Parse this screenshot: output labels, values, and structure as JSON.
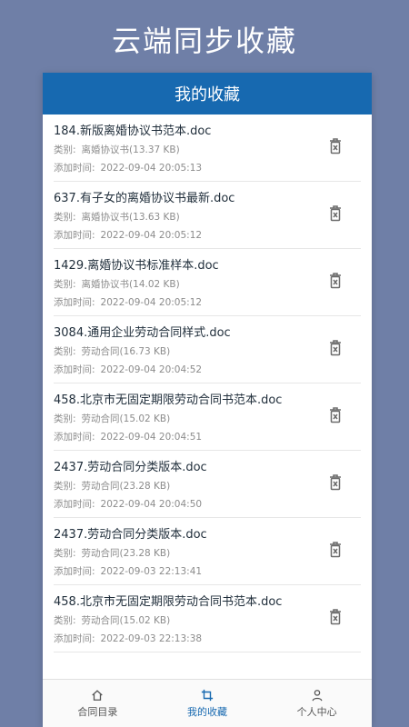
{
  "header": {
    "title": "云端同步收藏"
  },
  "card": {
    "title": "我的收藏"
  },
  "labels": {
    "category": "类别:",
    "added": "添加时间:"
  },
  "items": [
    {
      "name": "184.新版离婚协议书范本.doc",
      "category": "离婚协议书",
      "size": "(13.37 KB)",
      "time": "2022-09-04 20:05:13"
    },
    {
      "name": "637.有子女的离婚协议书最新.doc",
      "category": "离婚协议书",
      "size": "(13.63 KB)",
      "time": "2022-09-04 20:05:12"
    },
    {
      "name": "1429.离婚协议书标准样本.doc",
      "category": "离婚协议书",
      "size": "(14.02 KB)",
      "time": "2022-09-04 20:05:12"
    },
    {
      "name": "3084.通用企业劳动合同样式.doc",
      "category": "劳动合同",
      "size": "(16.73 KB)",
      "time": "2022-09-04 20:04:52"
    },
    {
      "name": "458.北京市无固定期限劳动合同书范本.doc",
      "category": "劳动合同",
      "size": "(15.02 KB)",
      "time": "2022-09-04 20:04:51"
    },
    {
      "name": "2437.劳动合同分类版本.doc",
      "category": "劳动合同",
      "size": "(23.28 KB)",
      "time": "2022-09-04 20:04:50"
    },
    {
      "name": "2437.劳动合同分类版本.doc",
      "category": "劳动合同",
      "size": "(23.28 KB)",
      "time": "2022-09-03 22:13:41"
    },
    {
      "name": "458.北京市无固定期限劳动合同书范本.doc",
      "category": "劳动合同",
      "size": "(15.02 KB)",
      "time": "2022-09-03 22:13:38"
    }
  ],
  "tabs": [
    {
      "label": "合同目录",
      "icon": "home-icon",
      "active": false
    },
    {
      "label": "我的收藏",
      "icon": "crop-icon",
      "active": true
    },
    {
      "label": "个人中心",
      "icon": "user-icon",
      "active": false
    }
  ],
  "colors": {
    "background": "#6f7fa7",
    "accent": "#1769b0",
    "text": "#1f2d3a",
    "muted": "#8c8c8c"
  }
}
